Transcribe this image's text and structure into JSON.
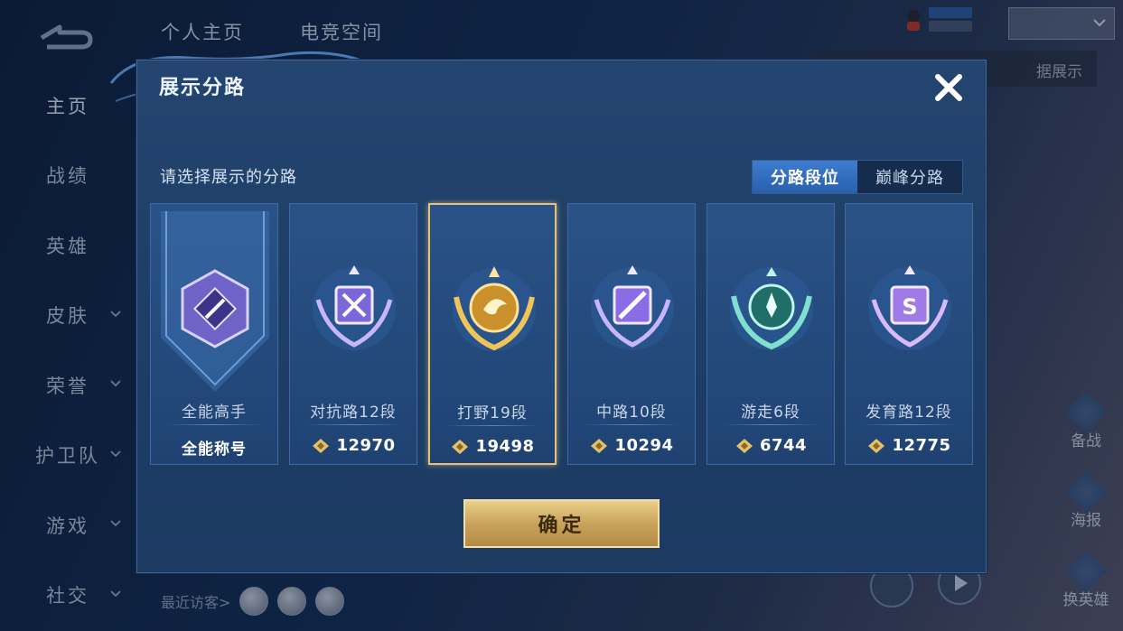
{
  "top_tabs": [
    "个人主页",
    "电竞空间"
  ],
  "sidebar": [
    {
      "label": "主页",
      "active": true,
      "chevron": false
    },
    {
      "label": "战绩",
      "active": false,
      "chevron": false
    },
    {
      "label": "英雄",
      "active": false,
      "chevron": false
    },
    {
      "label": "皮肤",
      "active": false,
      "chevron": true
    },
    {
      "label": "荣誉",
      "active": false,
      "chevron": true
    },
    {
      "label": "护卫队",
      "active": false,
      "chevron": true
    },
    {
      "label": "游戏",
      "active": false,
      "chevron": true
    },
    {
      "label": "社交",
      "active": false,
      "chevron": true
    }
  ],
  "recent_visitors_label": "最近访客>",
  "right_buttons": [
    {
      "label": "备战",
      "icon": "prepare-icon"
    },
    {
      "label": "海报",
      "icon": "poster-icon"
    },
    {
      "label": "换英雄",
      "icon": "switch-hero-icon"
    }
  ],
  "background_banner_fragment": "据展示",
  "modal": {
    "title": "展示分路",
    "prompt": "请选择展示的分路",
    "toggle": [
      {
        "label": "分路段位",
        "active": true
      },
      {
        "label": "巅峰分路",
        "active": false
      }
    ],
    "cards": [
      {
        "rank": "全能高手",
        "value": "全能称号",
        "selected": false,
        "emblem": "all-round-emblem-icon",
        "color": "#8a7fe0"
      },
      {
        "rank": "对抗路12段",
        "value": "12970",
        "selected": false,
        "emblem": "clash-lane-emblem-icon",
        "color": "#9c84ea"
      },
      {
        "rank": "打野19段",
        "value": "19498",
        "selected": true,
        "emblem": "jungle-emblem-icon",
        "color": "#e4b04a"
      },
      {
        "rank": "中路10段",
        "value": "10294",
        "selected": false,
        "emblem": "mid-lane-emblem-icon",
        "color": "#a17ff0"
      },
      {
        "rank": "游走6段",
        "value": "6744",
        "selected": false,
        "emblem": "roam-emblem-icon",
        "color": "#48c2b2"
      },
      {
        "rank": "发育路12段",
        "value": "12775",
        "selected": false,
        "emblem": "farm-lane-emblem-icon",
        "color": "#b58aee"
      }
    ],
    "confirm_label": "确定"
  },
  "colors": {
    "accent_blue": "#3e7cd0",
    "gold": "#e5c27a",
    "modal_bg": "#23456f"
  }
}
